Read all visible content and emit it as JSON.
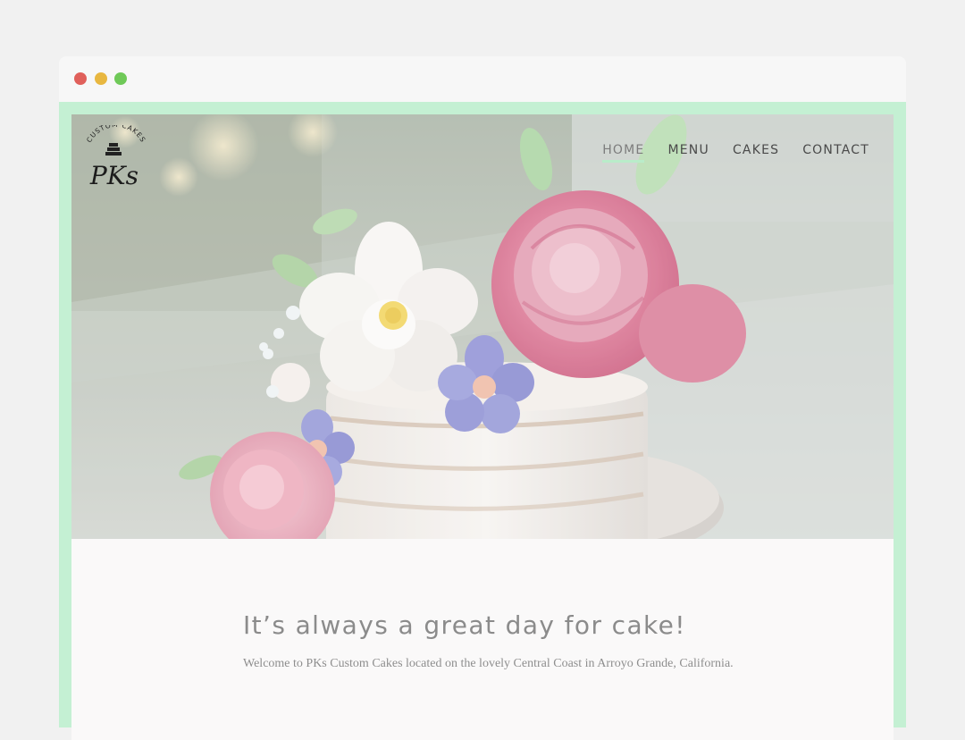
{
  "browser": {
    "traffic_lights": {
      "close_color": "#e0605b",
      "minimize_color": "#e8b740",
      "maximize_color": "#6fc958"
    },
    "frame_color": "#c4f0d3"
  },
  "site": {
    "logo": {
      "arc_text": "CUSTOM CAKES",
      "monogram": "PKs"
    },
    "nav": [
      {
        "label": "HOME",
        "active": true
      },
      {
        "label": "MENU",
        "active": false
      },
      {
        "label": "CAKES",
        "active": false
      },
      {
        "label": "CONTACT",
        "active": false
      }
    ],
    "hero": {
      "image_subject": "naked-layer-cake-with-sugar-flowers"
    },
    "headline": "It’s always a great day for cake!",
    "intro": "Welcome to PKs Custom Cakes located on the lovely Central Coast in Arroyo Grande, California."
  }
}
